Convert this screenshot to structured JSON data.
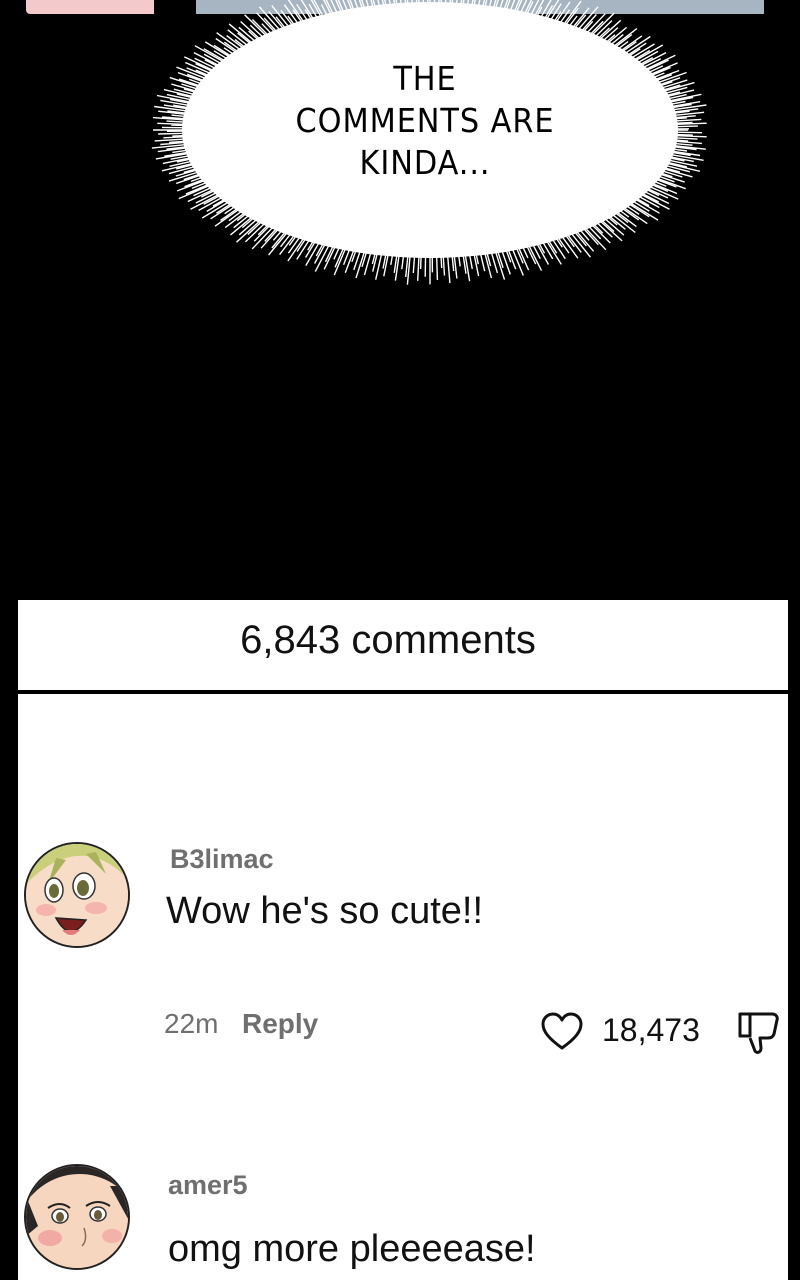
{
  "speech_bubble": {
    "text": "THE\nCOMMENTS ARE\nKINDA..."
  },
  "comments_panel": {
    "count_label": "6,843 comments",
    "comments": [
      {
        "username": "B3limac",
        "text": "Wow he's so cute!!",
        "time": "22m",
        "reply_label": "Reply",
        "likes": "18,473",
        "avatar_icon": "avatar-face-blonde",
        "like_icon": "heart-outline-icon",
        "dislike_icon": "thumbs-down-outline-icon"
      },
      {
        "username": "amer5",
        "text": "omg more pleeeease!",
        "avatar_icon": "avatar-face-dark-hair"
      }
    ]
  },
  "colors": {
    "background": "#000000",
    "panel": "#ffffff",
    "muted_text": "#6f6f6f",
    "top_strip_pink": "#f3c9cb",
    "top_strip_blue": "#a7b4c2"
  }
}
